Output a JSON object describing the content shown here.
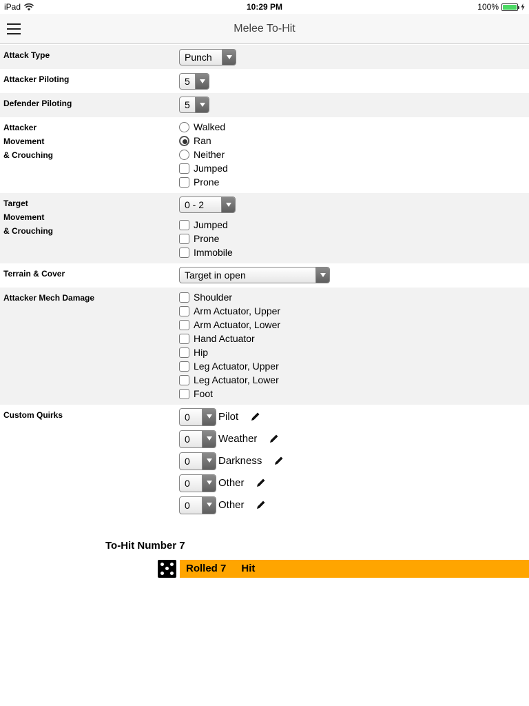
{
  "status_bar": {
    "device": "iPad",
    "time": "10:29 PM",
    "battery": "100%"
  },
  "nav": {
    "title": "Melee To-Hit"
  },
  "form": {
    "attack_type": {
      "label": "Attack Type",
      "value": "Punch"
    },
    "attacker_piloting": {
      "label": "Attacker Piloting",
      "value": "5"
    },
    "defender_piloting": {
      "label": "Defender Piloting",
      "value": "5"
    },
    "attacker_movement": {
      "label_lines": [
        "Attacker",
        "Movement",
        "& Crouching"
      ],
      "radios": [
        {
          "label": "Walked",
          "selected": false
        },
        {
          "label": "Ran",
          "selected": true
        },
        {
          "label": "Neither",
          "selected": false
        }
      ],
      "checks": [
        "Jumped",
        "Prone"
      ]
    },
    "target_movement": {
      "label_lines": [
        "Target",
        "Movement",
        "& Crouching"
      ],
      "range_value": "0 - 2",
      "checks": [
        "Jumped",
        "Prone",
        "Immobile"
      ]
    },
    "terrain": {
      "label": "Terrain & Cover",
      "value": "Target in open"
    },
    "mech_damage": {
      "label": "Attacker Mech Damage",
      "checks": [
        "Shoulder",
        "Arm Actuator, Upper",
        "Arm Actuator, Lower",
        "Hand Actuator",
        "Hip",
        "Leg Actuator, Upper",
        "Leg Actuator, Lower",
        "Foot"
      ]
    },
    "quirks": {
      "label": "Custom Quirks",
      "items": [
        {
          "value": "0",
          "name": "Pilot"
        },
        {
          "value": "0",
          "name": "Weather"
        },
        {
          "value": "0",
          "name": "Darkness"
        },
        {
          "value": "0",
          "name": "Other"
        },
        {
          "value": "0",
          "name": "Other"
        }
      ]
    }
  },
  "result": {
    "to_hit_label": "To-Hit Number 7",
    "rolled": "Rolled 7",
    "outcome": "Hit",
    "die_face": 5,
    "bar_color": "#ffa500"
  }
}
